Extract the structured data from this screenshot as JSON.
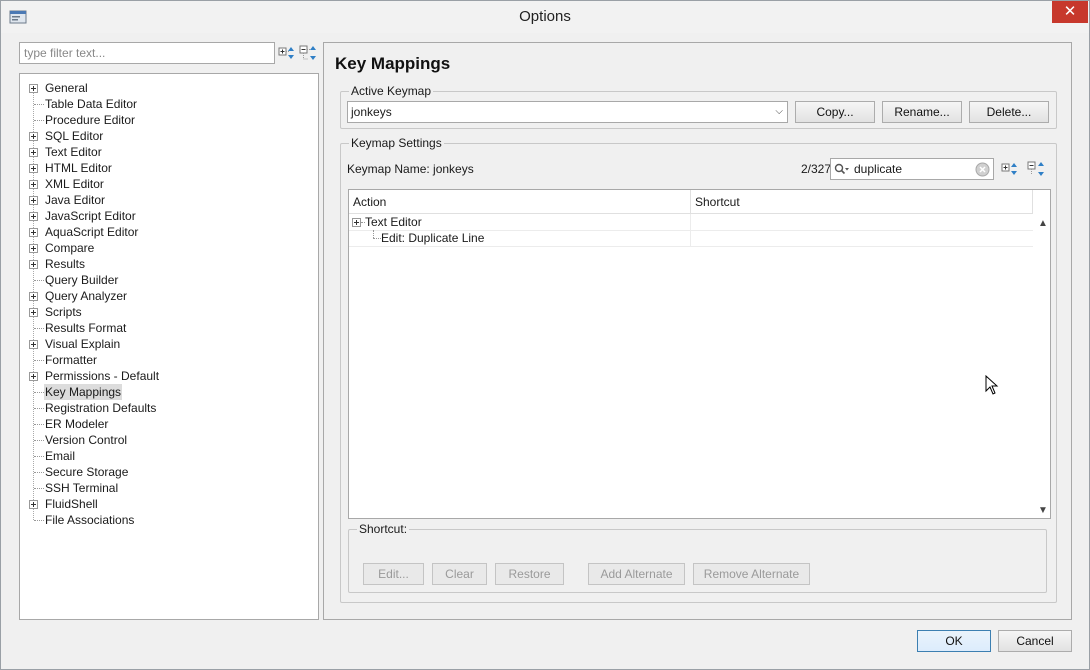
{
  "window": {
    "title": "Options",
    "close_glyph": "✕"
  },
  "sidebar": {
    "filter_placeholder": "type filter text...",
    "items": [
      {
        "label": "General",
        "expandable": true
      },
      {
        "label": "Table Data Editor",
        "expandable": false
      },
      {
        "label": "Procedure Editor",
        "expandable": false
      },
      {
        "label": "SQL Editor",
        "expandable": true
      },
      {
        "label": "Text Editor",
        "expandable": true
      },
      {
        "label": "HTML Editor",
        "expandable": true
      },
      {
        "label": "XML Editor",
        "expandable": true
      },
      {
        "label": "Java Editor",
        "expandable": true
      },
      {
        "label": "JavaScript Editor",
        "expandable": true
      },
      {
        "label": "AquaScript Editor",
        "expandable": true
      },
      {
        "label": "Compare",
        "expandable": true
      },
      {
        "label": "Results",
        "expandable": true
      },
      {
        "label": "Query Builder",
        "expandable": false
      },
      {
        "label": "Query Analyzer",
        "expandable": true
      },
      {
        "label": "Scripts",
        "expandable": true
      },
      {
        "label": "Results Format",
        "expandable": false
      },
      {
        "label": "Visual Explain",
        "expandable": true
      },
      {
        "label": "Formatter",
        "expandable": false
      },
      {
        "label": "Permissions - Default",
        "expandable": true
      },
      {
        "label": "Key Mappings",
        "expandable": false,
        "selected": true
      },
      {
        "label": "Registration Defaults",
        "expandable": false
      },
      {
        "label": "ER Modeler",
        "expandable": false
      },
      {
        "label": "Version Control",
        "expandable": false
      },
      {
        "label": "Email",
        "expandable": false
      },
      {
        "label": "Secure Storage",
        "expandable": false
      },
      {
        "label": "SSH Terminal",
        "expandable": false
      },
      {
        "label": "FluidShell",
        "expandable": true
      },
      {
        "label": "File Associations",
        "expandable": false
      }
    ]
  },
  "main": {
    "title": "Key Mappings",
    "active_keymap": {
      "legend": "Active Keymap",
      "selected": "jonkeys",
      "copy_label": "Copy...",
      "rename_label": "Rename...",
      "delete_label": "Delete..."
    },
    "keymap_settings": {
      "legend": "Keymap Settings",
      "name_label": "Keymap Name: jonkeys",
      "match_count": "2/327",
      "search_value": "duplicate",
      "columns": [
        "Action",
        "Shortcut"
      ],
      "rows": [
        {
          "action": "Text Editor",
          "shortcut": "",
          "level": 0
        },
        {
          "action": "Edit: Duplicate Line",
          "shortcut": "",
          "level": 1
        }
      ]
    },
    "shortcut": {
      "legend": "Shortcut:",
      "edit_label": "Edit...",
      "clear_label": "Clear",
      "restore_label": "Restore",
      "add_alternate_label": "Add Alternate",
      "remove_alternate_label": "Remove Alternate"
    }
  },
  "footer": {
    "ok_label": "OK",
    "cancel_label": "Cancel"
  }
}
